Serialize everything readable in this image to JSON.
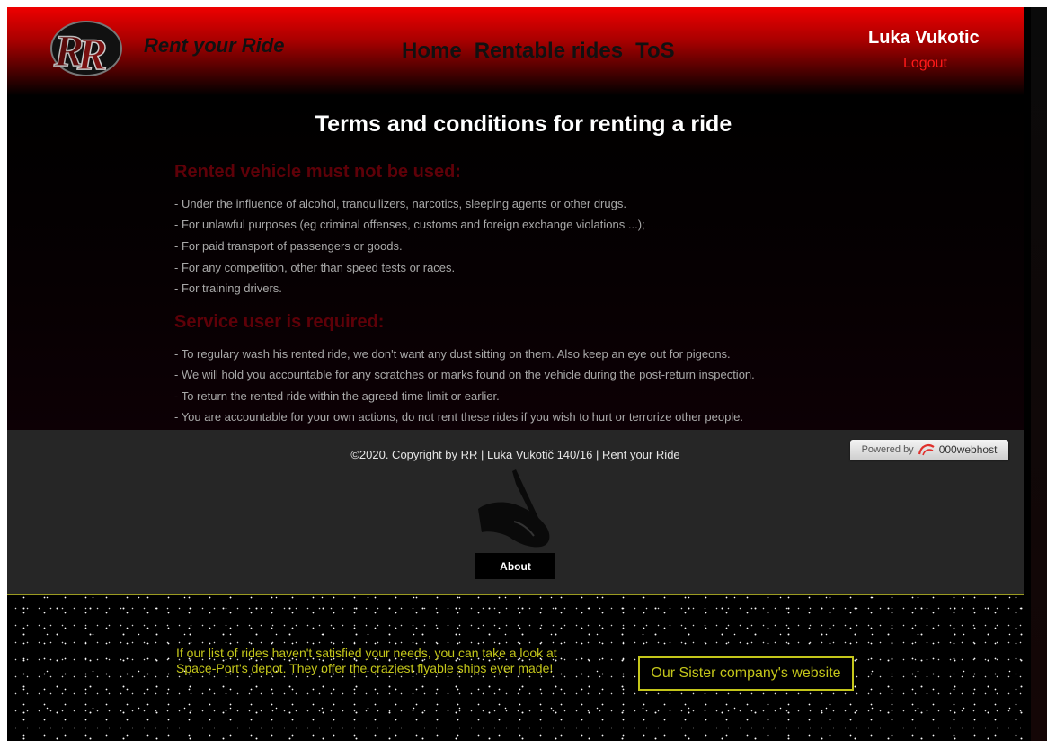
{
  "header": {
    "brand": "Rent your Ride",
    "nav": [
      {
        "label": "Home"
      },
      {
        "label": "Rentable rides"
      },
      {
        "label": "ToS"
      }
    ],
    "user_name": "Luka Vukotic",
    "logout_label": "Logout"
  },
  "main": {
    "title": "Terms and conditions for renting a ride",
    "sections": [
      {
        "heading": "Rented vehicle must not be used:",
        "items": [
          "- Under the influence of alcohol, tranquilizers, narcotics, sleeping agents or other drugs.",
          "- For unlawful purposes (eg criminal offenses, customs and foreign exchange violations ...);",
          "- For paid transport of passengers or goods.",
          "- For any competition, other than speed tests or races.",
          "- For training drivers."
        ]
      },
      {
        "heading": "Service user is required:",
        "items": [
          "- To regulary wash his rented ride, we don't want any dust sitting on them. Also keep an eye out for pigeons.",
          "- We will hold you accountable for any scratches or marks found on the vehicle during the post-return inspection.",
          "- To return the rented ride within the agreed time limit or earlier.",
          "- You are accountable for your own actions, do not rent these rides if you wish to hurt or terrorize other people."
        ]
      }
    ]
  },
  "footer": {
    "copyright": "©2020. Copyright by RR | Luka Vukotič 140/16 | Rent your Ride",
    "badge_prefix": "Powered by",
    "badge_brand": "000webhost",
    "about_label": "About"
  },
  "bottom": {
    "text": "If our list of rides haven't satisfied your needs, you can take a look at Space-Port's depot. They offer the craziest flyable ships ever made!",
    "button_label": "Our Sister company's website"
  },
  "colors": {
    "header_red": "#ee0000",
    "section_heading": "#5e0008",
    "logout_red": "#ff1a1a",
    "sister_yellow": "#c4c61a",
    "footer_gray": "#262626"
  },
  "icons": {
    "logo": "rr-logo-icon",
    "hand": "hand-writing-icon",
    "badge": "000webhost-swirl-icon"
  }
}
